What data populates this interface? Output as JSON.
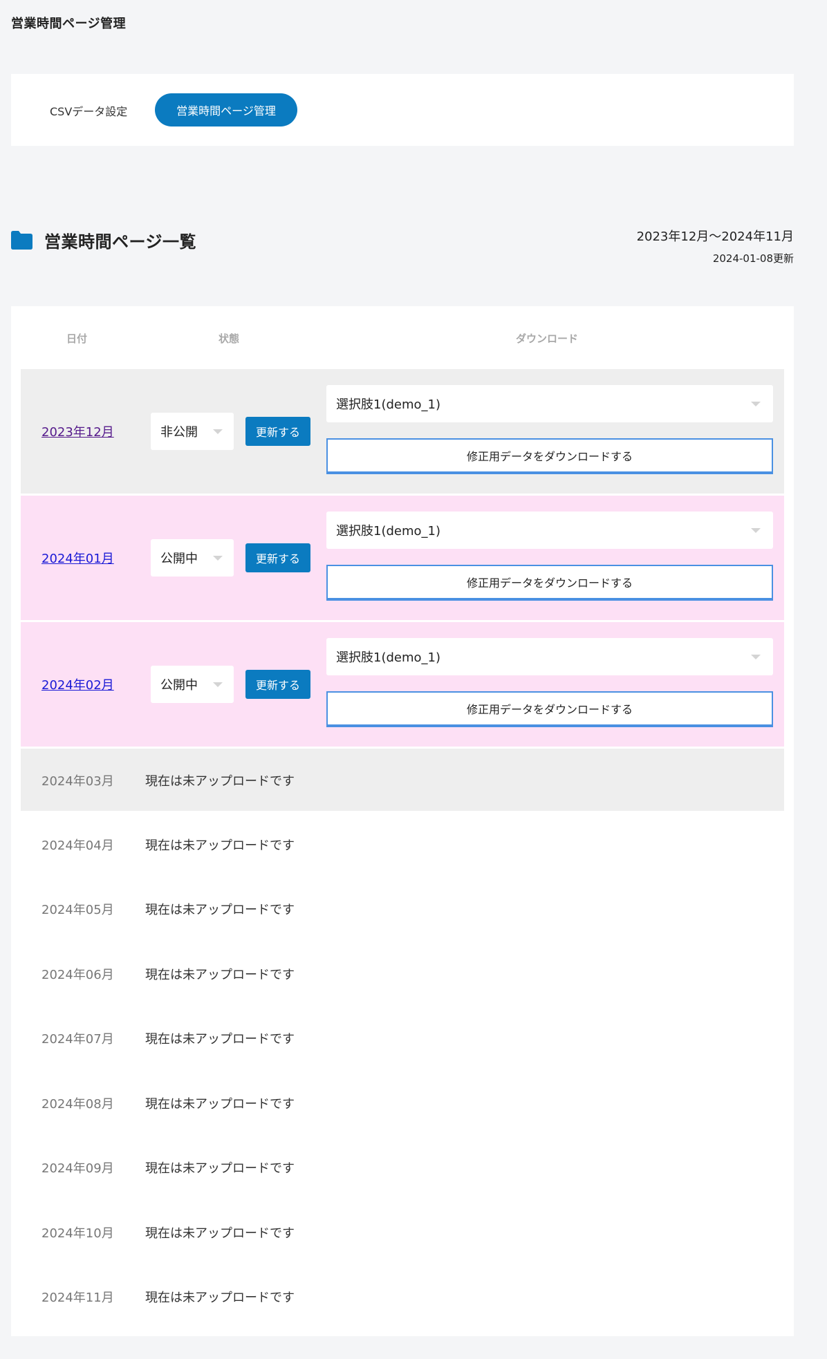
{
  "header": {
    "title": "営業時間ページ管理"
  },
  "tabs": [
    {
      "label": "CSVデータ設定"
    },
    {
      "label": "営業時間ページ管理"
    }
  ],
  "section": {
    "title": "営業時間ページ一覧",
    "range": "2023年12月〜2024年11月",
    "updated": "2024-01-08更新",
    "folder_icon": "folder-icon",
    "accent": "#0b7bc0"
  },
  "table": {
    "headers": {
      "date": "日付",
      "state": "状態",
      "download": "ダウンロード"
    },
    "active_rows": [
      {
        "date": "2023年12月",
        "state": "非公開",
        "update": "更新する",
        "choice": "選択肢1(demo_1)",
        "download": "修正用データをダウンロードする"
      },
      {
        "date": "2024年01月",
        "state": "公開中",
        "update": "更新する",
        "choice": "選択肢1(demo_1)",
        "download": "修正用データをダウンロードする"
      },
      {
        "date": "2024年02月",
        "state": "公開中",
        "update": "更新する",
        "choice": "選択肢1(demo_1)",
        "download": "修正用データをダウンロードする"
      }
    ],
    "empty_rows": [
      {
        "date": "2024年03月",
        "note": "現在は未アップロードです"
      },
      {
        "date": "2024年04月",
        "note": "現在は未アップロードです"
      },
      {
        "date": "2024年05月",
        "note": "現在は未アップロードです"
      },
      {
        "date": "2024年06月",
        "note": "現在は未アップロードです"
      },
      {
        "date": "2024年07月",
        "note": "現在は未アップロードです"
      },
      {
        "date": "2024年08月",
        "note": "現在は未アップロードです"
      },
      {
        "date": "2024年09月",
        "note": "現在は未アップロードです"
      },
      {
        "date": "2024年10月",
        "note": "現在は未アップロードです"
      },
      {
        "date": "2024年11月",
        "note": "現在は未アップロードです"
      }
    ]
  }
}
